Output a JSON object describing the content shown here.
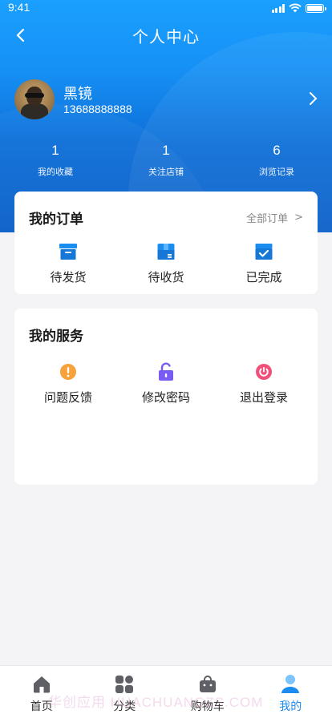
{
  "status_bar": {
    "time": "9:41"
  },
  "nav": {
    "title": "个人中心"
  },
  "profile": {
    "name": "黑镜",
    "phone": "13688888888"
  },
  "stats": [
    {
      "value": "1",
      "label": "我的收藏"
    },
    {
      "value": "1",
      "label": "关注店铺"
    },
    {
      "value": "6",
      "label": "浏览记录"
    }
  ],
  "orders": {
    "title": "我的订单",
    "more_label": "全部订单",
    "more_arrow": ">",
    "items": [
      {
        "label": "待发货",
        "icon": "pending-shipment-icon"
      },
      {
        "label": "待收货",
        "icon": "pending-receipt-icon"
      },
      {
        "label": "已完成",
        "icon": "completed-icon"
      }
    ]
  },
  "services": {
    "title": "我的服务",
    "items": [
      {
        "label": "问题反馈",
        "icon": "feedback-icon"
      },
      {
        "label": "修改密码",
        "icon": "lock-icon"
      },
      {
        "label": "退出登录",
        "icon": "logout-icon"
      }
    ]
  },
  "tab_bar": {
    "tabs": [
      {
        "label": "首页",
        "icon": "home-icon"
      },
      {
        "label": "分类",
        "icon": "category-icon"
      },
      {
        "label": "购物车",
        "icon": "cart-icon"
      },
      {
        "label": "我的",
        "icon": "profile-icon",
        "active": true
      }
    ]
  },
  "watermark": "华创应用 HUACHUANGZS.COM",
  "colors": {
    "primary": "#1690f5",
    "accent_active": "#1b8cf0",
    "feedback": "#f7a23b",
    "lock": "#7a5cf5",
    "logout": "#f0507a"
  }
}
